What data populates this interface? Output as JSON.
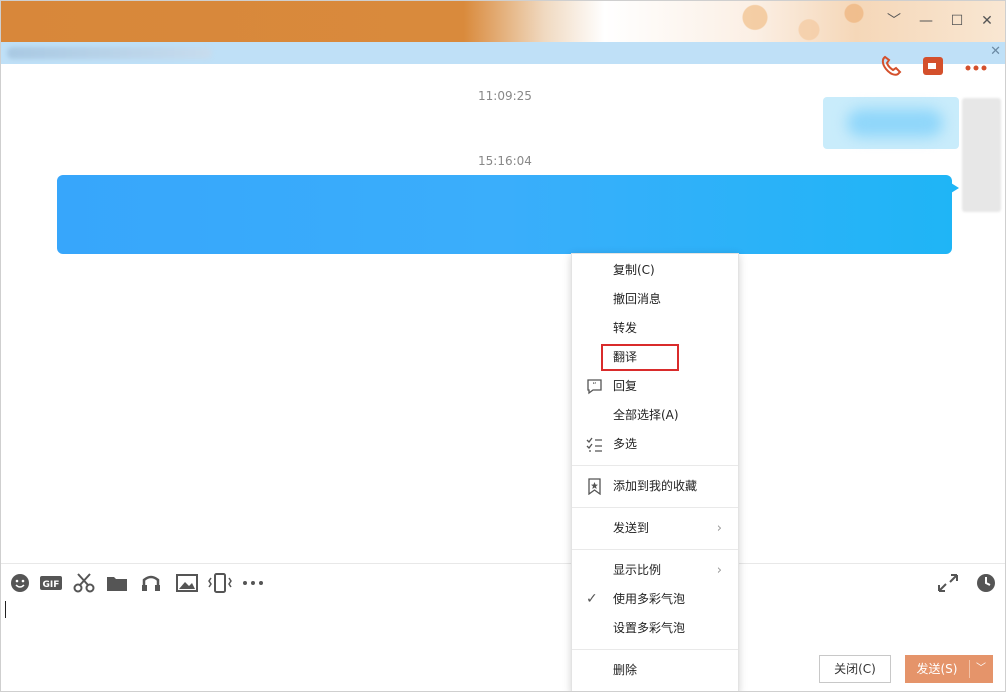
{
  "window": {
    "buttons": {
      "minimize": "—",
      "maximize": "☐",
      "close": "✕",
      "dropdown": "﹀"
    }
  },
  "notice": {
    "close": "✕"
  },
  "chat": {
    "timestamps": [
      "11:09:25",
      "15:16:04"
    ]
  },
  "toolbar": {
    "icons": [
      "emoji-icon",
      "gif-icon",
      "scissors-icon",
      "folder-icon",
      "music-icon",
      "image-icon",
      "shake-icon",
      "more-icon",
      "expand-icon",
      "history-icon"
    ]
  },
  "context_menu": {
    "items": [
      {
        "label": "复制(C)"
      },
      {
        "label": "撤回消息"
      },
      {
        "label": "转发"
      },
      {
        "label": "翻译"
      },
      {
        "label": "回复"
      },
      {
        "label": "全部选择(A)"
      },
      {
        "label": "多选"
      },
      {
        "label": "添加到我的收藏"
      },
      {
        "label": "发送到",
        "submenu": "›"
      },
      {
        "label": "显示比例",
        "submenu": "›"
      },
      {
        "label": "使用多彩气泡",
        "checked": "✓"
      },
      {
        "label": "设置多彩气泡"
      },
      {
        "label": "删除"
      }
    ]
  },
  "footer": {
    "close_label": "关闭(C)",
    "send_label": "发送(S)",
    "send_arrow": "﹀"
  }
}
